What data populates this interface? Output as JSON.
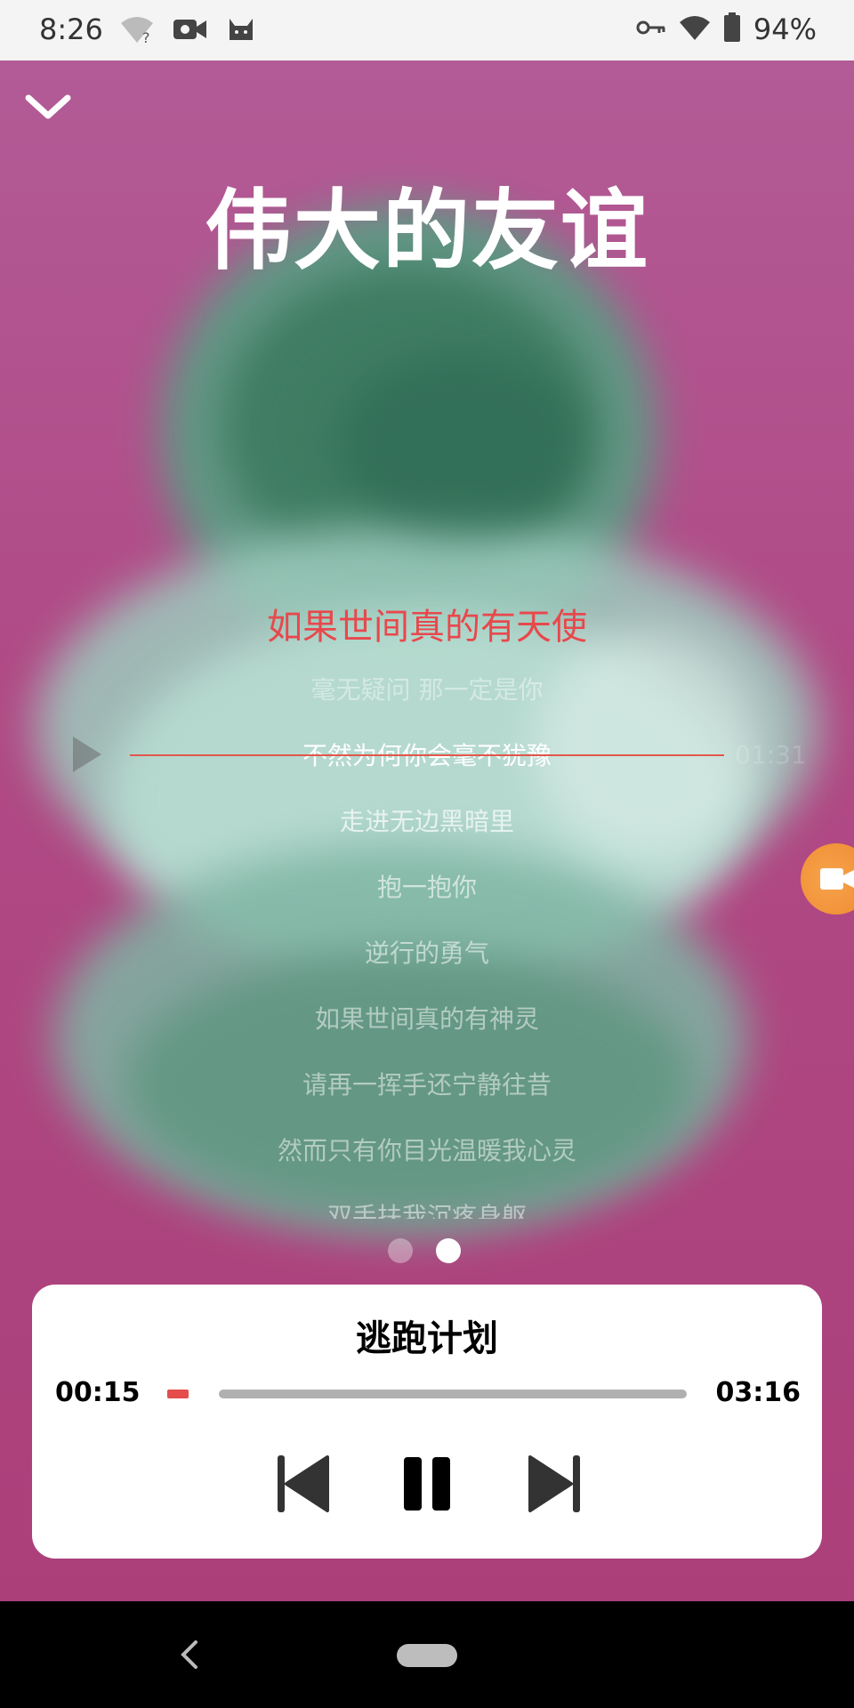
{
  "status_bar": {
    "time": "8:26",
    "battery_percent": "94%",
    "icons": [
      "wifi-question-icon",
      "video-camera-icon",
      "cat-icon",
      "key-icon",
      "wifi-icon",
      "battery-icon"
    ]
  },
  "header": {
    "collapse_icon": "chevron-down-icon",
    "song_title": "伟大的友谊"
  },
  "lyrics": {
    "active_line": "如果世间真的有天使",
    "lines": [
      "毫无疑问 那一定是你",
      "不然为何你会毫不犹豫",
      "走进无边黑暗里",
      "抱一抱你",
      "逆行的勇气",
      "如果世间真的有神灵",
      "请再一挥手还宁静往昔",
      "然而只有你目光温暖我心灵",
      "双手扶我沉疼身躯"
    ],
    "seek_time": "01:31"
  },
  "page_indicator": {
    "count": 2,
    "active_index": 1
  },
  "player": {
    "track_name": "逃跑计划",
    "elapsed": "00:15",
    "duration": "03:16",
    "progress_fraction": 0.077,
    "controls": [
      "previous-icon",
      "pause-icon",
      "next-icon"
    ]
  },
  "colors": {
    "accent": "#e8484c",
    "background": "#b04a86",
    "floating_button": "#f08a33"
  }
}
